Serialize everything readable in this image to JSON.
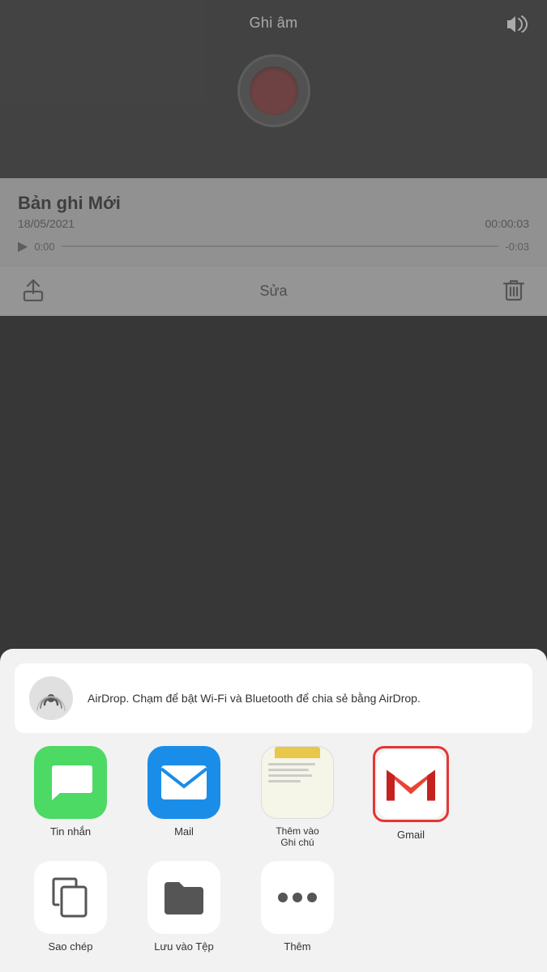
{
  "topBar": {
    "title": "Ghi âm",
    "speakerIcon": "🔊"
  },
  "recordingInfo": {
    "title": "Bản ghi Mới",
    "date": "18/05/2021",
    "duration": "00:00:03",
    "currentTime": "0:00",
    "remainingTime": "-0:03"
  },
  "toolbar": {
    "editLabel": "Sửa",
    "shareIcon": "share",
    "deleteIcon": "trash"
  },
  "shareSheet": {
    "airdrop": {
      "name": "AirDrop",
      "description": "AirDrop. Chạm để bật Wi-Fi và Bluetooth để chia sẻ bằng AirDrop."
    },
    "apps": [
      {
        "id": "messages",
        "label": "Tin nhắn",
        "type": "messages"
      },
      {
        "id": "mail",
        "label": "Mail",
        "type": "mail"
      },
      {
        "id": "notes",
        "label": "Thêm vào\nGhi chú",
        "type": "notes"
      },
      {
        "id": "gmail",
        "label": "Gmail",
        "type": "gmail"
      }
    ],
    "actions": [
      {
        "id": "copy",
        "label": "Sao chép",
        "icon": "copy"
      },
      {
        "id": "save-to-files",
        "label": "Lưu vào Tệp",
        "icon": "folder"
      },
      {
        "id": "more",
        "label": "Thêm",
        "icon": "more"
      }
    ]
  }
}
